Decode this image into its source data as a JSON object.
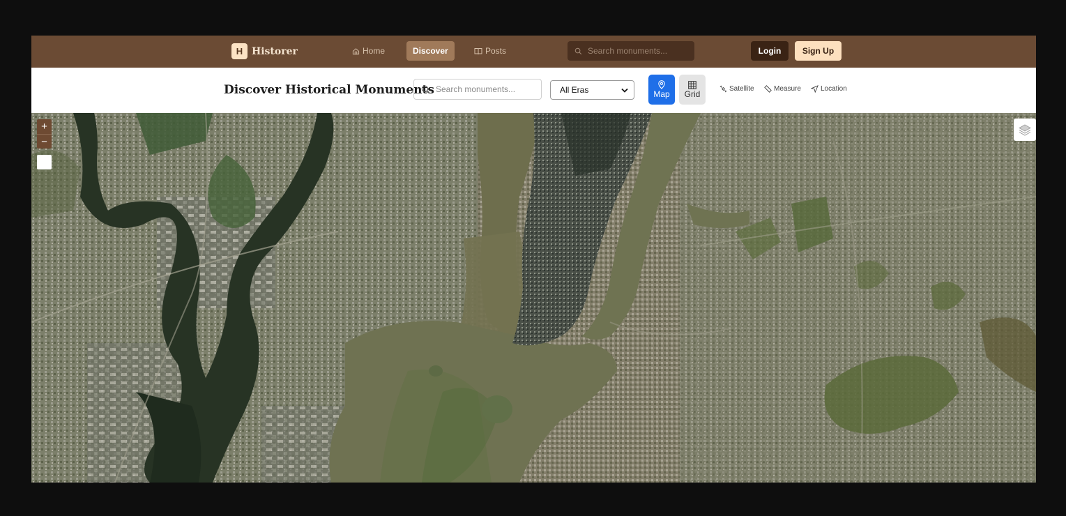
{
  "nav": {
    "brand_letter": "H",
    "brand_name": "Historer",
    "links": [
      {
        "label": "Home",
        "icon": "home-icon"
      },
      {
        "label": "Discover",
        "icon": ""
      },
      {
        "label": "Posts",
        "icon": "book-icon"
      }
    ],
    "search_placeholder": "Search monuments...",
    "login_label": "Login",
    "signup_label": "Sign Up"
  },
  "toolbar": {
    "title": "Discover Historical Monuments",
    "search_placeholder": "Search monuments...",
    "era_selected": "All Eras",
    "view_map_label": "Map",
    "view_grid_label": "Grid",
    "satellite_label": "Satellite",
    "measure_label": "Measure",
    "location_label": "Location"
  },
  "map": {
    "zoom_in_label": "+",
    "zoom_out_label": "−",
    "basemap": "satellite"
  },
  "colors": {
    "nav_bg": "#6b4b34",
    "active_view": "#1f6fe8",
    "signup_bg": "#fde0bf",
    "page_bg": "#0e0e0e"
  }
}
